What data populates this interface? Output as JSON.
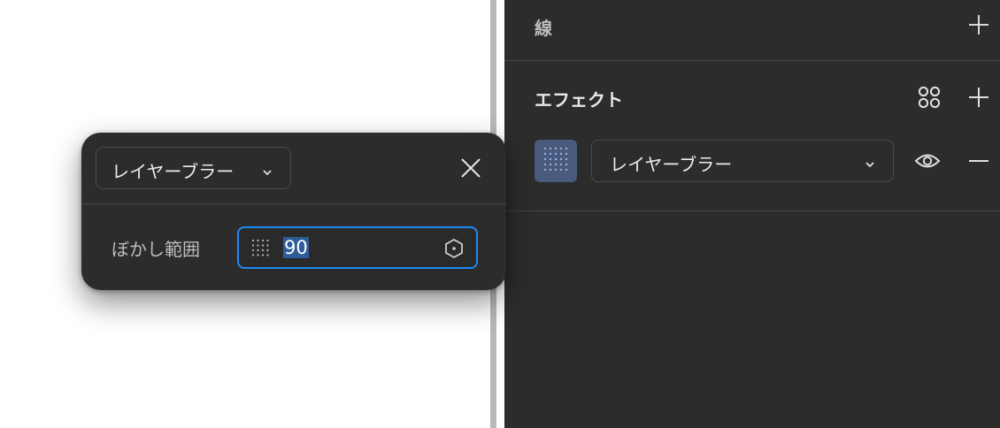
{
  "panel": {
    "stroke_section": {
      "title": "線",
      "add_icon": "plus-icon"
    },
    "effect_section": {
      "title": "エフェクト",
      "styles_icon": "four-dots-icon",
      "add_icon": "plus-icon",
      "effect": {
        "type_label": "レイヤーブラー",
        "swatch_icon": "blur-grid-icon",
        "visibility_icon": "eye-icon",
        "remove_icon": "minus-icon"
      }
    }
  },
  "popup": {
    "type_label": "レイヤーブラー",
    "close_icon": "close-icon",
    "blur_label": "ぼかし範囲",
    "blur_value": "90",
    "blur_icon": "blur-grid-icon",
    "variable_icon": "hexagon-icon"
  },
  "colors": {
    "panel_bg": "#2c2c2c",
    "accent": "#1c8cf0",
    "swatch": "#4a5a7c"
  }
}
